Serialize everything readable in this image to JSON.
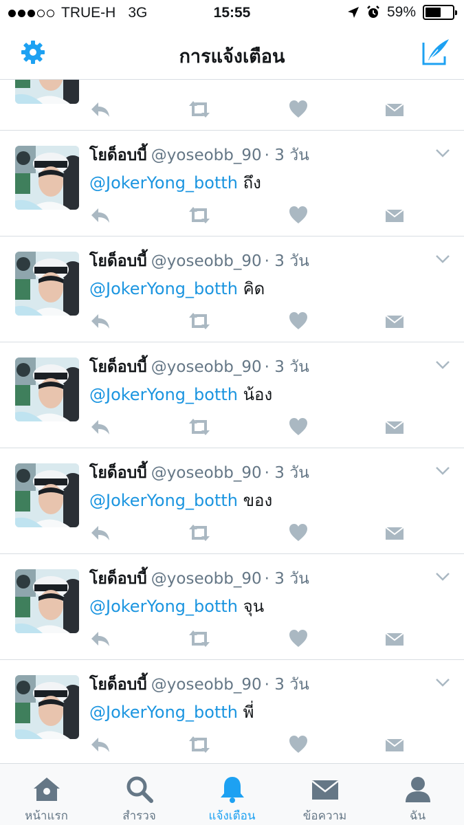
{
  "status_bar": {
    "carrier": "TRUE-H",
    "network": "3G",
    "time": "15:55",
    "battery": "59%",
    "battery_level": 0.59
  },
  "nav": {
    "title": "การแจ้งเตือน",
    "left_icon": "gear-icon",
    "right_icon": "compose-tweet-icon"
  },
  "colors": {
    "accent": "#1da1f2",
    "mention": "#1b95e0",
    "secondary_text": "#657786",
    "action_icon": "#aab8c2"
  },
  "tweets": [
    {
      "name": "",
      "handle": "",
      "time": "",
      "mention": "",
      "text": ""
    },
    {
      "name": "โยด็อบบี้",
      "handle": "@yoseobb_90",
      "time": "· 3 วัน",
      "mention": "@JokerYong_botth",
      "text": " ถึง"
    },
    {
      "name": "โยด็อบบี้",
      "handle": "@yoseobb_90",
      "time": "· 3 วัน",
      "mention": "@JokerYong_botth",
      "text": " คิด"
    },
    {
      "name": "โยด็อบบี้",
      "handle": "@yoseobb_90",
      "time": "· 3 วัน",
      "mention": "@JokerYong_botth",
      "text": " น้อง"
    },
    {
      "name": "โยด็อบบี้",
      "handle": "@yoseobb_90",
      "time": "· 3 วัน",
      "mention": "@JokerYong_botth",
      "text": " ของ"
    },
    {
      "name": "โยด็อบบี้",
      "handle": "@yoseobb_90",
      "time": "· 3 วัน",
      "mention": "@JokerYong_botth",
      "text": " จุน"
    },
    {
      "name": "โยด็อบบี้",
      "handle": "@yoseobb_90",
      "time": "· 3 วัน",
      "mention": "@JokerYong_botth",
      "text": " พี่"
    }
  ],
  "tabs": [
    {
      "label": "หน้าแรก",
      "icon": "home-icon"
    },
    {
      "label": "สำรวจ",
      "icon": "search-icon"
    },
    {
      "label": "แจ้งเตือน",
      "icon": "bell-icon",
      "active": true
    },
    {
      "label": "ข้อความ",
      "icon": "envelope-icon"
    },
    {
      "label": "ฉัน",
      "icon": "profile-icon"
    }
  ]
}
